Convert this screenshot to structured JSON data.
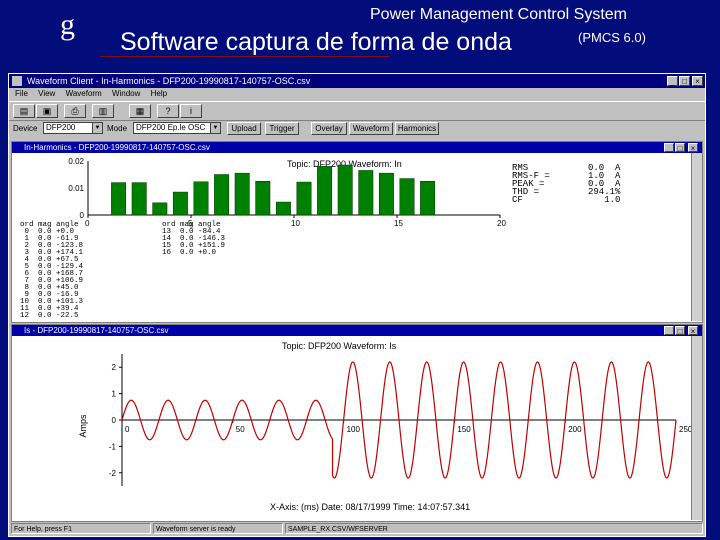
{
  "slide": {
    "logo_glyph": "g",
    "system_title": "Power Management Control System",
    "title": "Software captura de forma de onda",
    "version": "(PMCS 6.0)"
  },
  "app": {
    "title": "Waveform Client - In-Harmonics - DFP200-19990817-140757-OSC.csv",
    "window_buttons": [
      "_",
      "□",
      "×"
    ],
    "menu": [
      "File",
      "View",
      "Waveform",
      "Window",
      "Help"
    ],
    "toolbar_icons": [
      "open-icon",
      "save-icon",
      "print-icon",
      "harmonics-icon",
      "copy-icon",
      "help-icon",
      "info-icon"
    ],
    "device_label": "Device",
    "device_value": "DFP200",
    "mode_label": "Mode",
    "mode_value": "DFP200 Ep.le OSC",
    "buttons": [
      "Upload",
      "Trigger",
      "Overlay",
      "Waveform",
      "Harmonics"
    ],
    "status": {
      "left": "For Help, press F1",
      "middle": "Waveform server is ready",
      "right": "SAMPLE_RX.CSV/WFSERVER"
    }
  },
  "harmonics_window": {
    "title": "In-Harmonics - DFP200-19990817-140757-OSC.csv",
    "stats_labels": "RMS\nRMS-F =\nPEAK =\nTHD =\nCF",
    "stats_values": "0.0  A\n1.0  A\n0.0  A\n294.1%\n1.0",
    "table_left": "ord mag angle\n 0  0.0 +0.0\n 1  0.0 -61.9\n 2  0.0 -123.8\n 3  0.0 +174.1\n 4  0.0 +67.5\n 5  0.0 -129.4\n 6  0.0 +168.7\n 7  0.0 +106.9\n 8  0.0 +45.0\n 9  0.0 -16.9\n10  0.0 +101.3\n11  0.0 +39.4\n12  0.0 -22.5",
    "table_right": "ord mag angle\n13  0.0 -84.4\n14  0.0 -146.3\n15  0.0 +151.9\n16  0.0 +0.0"
  },
  "waveform_window": {
    "title": "Is - DFP200-19990817-140757-OSC.csv"
  },
  "chart_data": [
    {
      "type": "bar",
      "title": "Topic: DFP200  Waveform: In",
      "x": [
        0,
        1,
        2,
        3,
        4,
        5,
        6,
        7,
        8,
        9,
        10,
        11,
        12,
        13,
        14,
        15,
        16
      ],
      "values": [
        0,
        0.012,
        0.012,
        0.0045,
        0.0085,
        0.0123,
        0.015,
        0.0155,
        0.0125,
        0.0048,
        0.0122,
        0.018,
        0.0185,
        0.0165,
        0.0155,
        0.0135,
        0.0125
      ],
      "xticks": [
        "0",
        "5",
        "10",
        "15",
        "20"
      ],
      "yticks": [
        "0.02",
        "0.01",
        "0"
      ],
      "xlim": [
        0,
        20
      ],
      "ylim": [
        0,
        0.02
      ],
      "color": "#008000"
    },
    {
      "type": "line",
      "title": "Topic: DFP200  Waveform: Is",
      "xlabel": "X-Axis: (ms)   Date: 08/17/1999   Time: 14:07:57.341",
      "ylabel": "Amps",
      "xticks": [
        "0",
        "50",
        "100",
        "150",
        "200",
        "250"
      ],
      "yticks": [
        "2",
        "1",
        "0",
        "-1",
        "-2"
      ],
      "xlim": [
        0,
        250
      ],
      "ylim": [
        -2.5,
        2.5
      ],
      "series": [
        {
          "frequency_hz": 60,
          "segments": [
            {
              "x": [
                0,
                95
              ],
              "amplitude": 0.75
            },
            {
              "x": [
                95,
                250
              ],
              "amplitude": 2.2
            }
          ]
        }
      ],
      "color": "#c00000"
    }
  ]
}
